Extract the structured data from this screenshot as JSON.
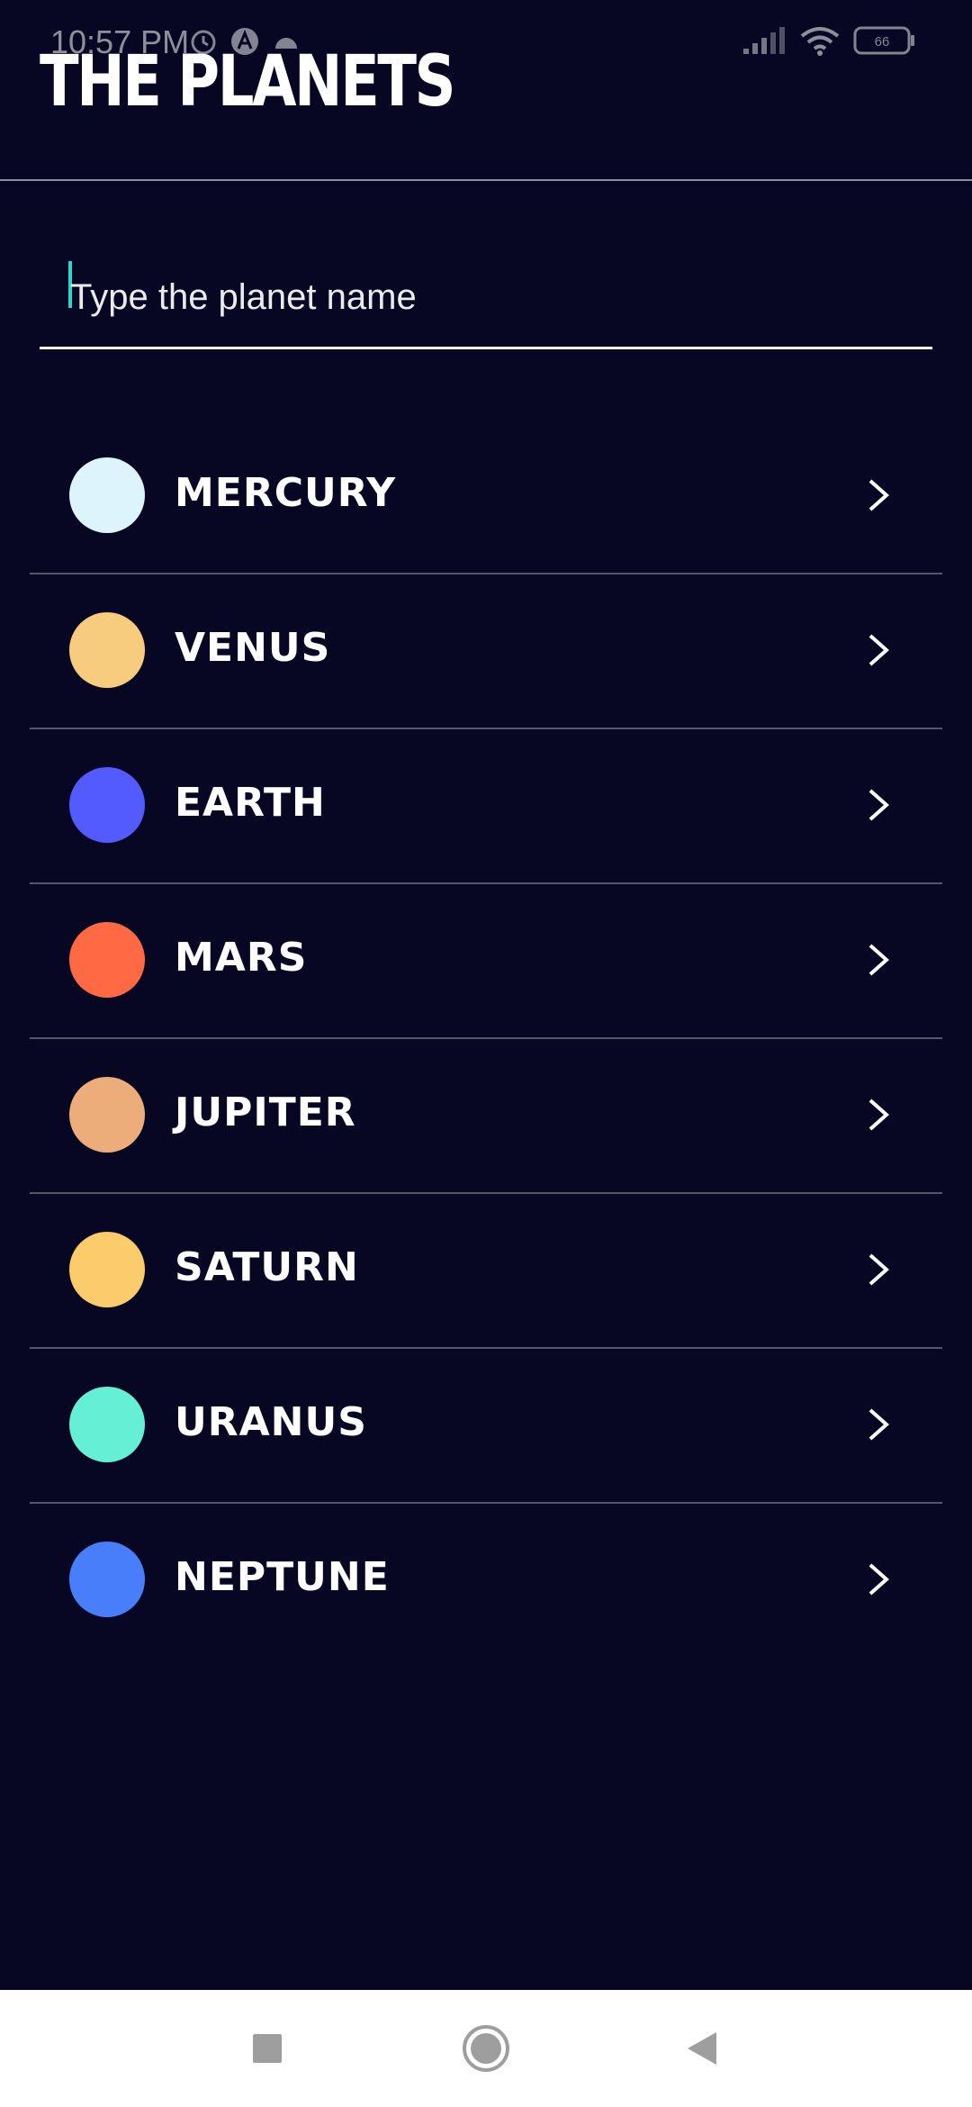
{
  "status_bar": {
    "time": "10:57 PM",
    "icons_left": [
      "alarm-icon",
      "a-badge-icon",
      "cloud-icon"
    ],
    "icons_right": [
      "signal-icon",
      "wifi-icon",
      "battery-icon"
    ],
    "battery_level": "66"
  },
  "header": {
    "title": "THE PLANETS"
  },
  "search": {
    "placeholder": "Type the planet name",
    "value": "",
    "cursor_color": "#2fd5c6"
  },
  "planets": [
    {
      "name": "MERCURY",
      "color": "#def4fc"
    },
    {
      "name": "VENUS",
      "color": "#f7cc7f"
    },
    {
      "name": "EARTH",
      "color": "#545bfe"
    },
    {
      "name": "MARS",
      "color": "#ff6a45"
    },
    {
      "name": "JUPITER",
      "color": "#ecad7a"
    },
    {
      "name": "SATURN",
      "color": "#fccb6b"
    },
    {
      "name": "URANUS",
      "color": "#65f0d5"
    },
    {
      "name": "NEPTUNE",
      "color": "#497efa"
    }
  ],
  "nav": {
    "items": [
      "recents-icon",
      "home-icon",
      "back-icon"
    ]
  },
  "theme": {
    "background": "#070724",
    "text": "#ffffff"
  }
}
